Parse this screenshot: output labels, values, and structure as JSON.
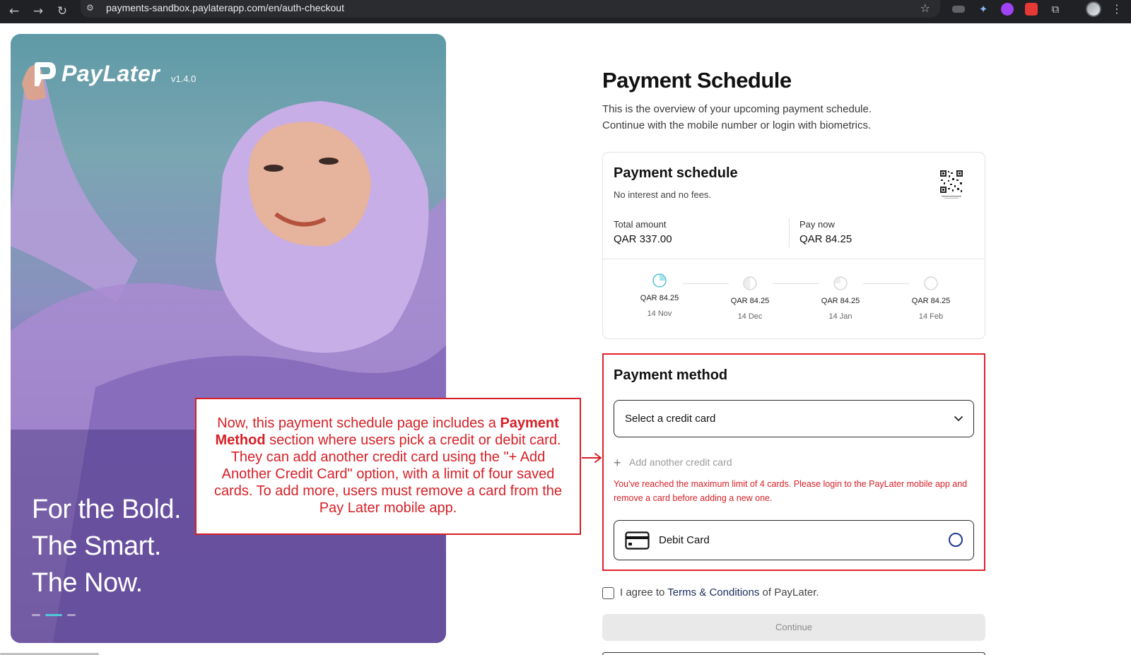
{
  "browser": {
    "url": "payments-sandbox.paylaterapp.com/en/auth-checkout",
    "icons": [
      "back-icon",
      "forward-icon",
      "reload-icon",
      "site-settings-icon",
      "bookmark-star-icon",
      "extensions-icon",
      "profile-avatar",
      "menu-icon"
    ]
  },
  "hero": {
    "brand_name": "PayLater",
    "version": "v1.4.0",
    "taglines": [
      "For the Bold.",
      "The Smart.",
      "The Now."
    ],
    "carousel_active_index": 1,
    "accent_color": "#52c6d8"
  },
  "header": {
    "title": "Payment Schedule",
    "subtitle_line1": "This is the overview of your upcoming payment schedule.",
    "subtitle_line2": "Continue with the mobile number or login with biometrics."
  },
  "schedule": {
    "title": "Payment schedule",
    "subtitle": "No interest and no fees.",
    "total_label": "Total amount",
    "total_value": "QAR 337.00",
    "paynow_label": "Pay now",
    "paynow_value": "QAR 84.25",
    "installments": [
      {
        "amount": "QAR 84.25",
        "date": "14 Nov",
        "progress": 0.25,
        "active": true
      },
      {
        "amount": "QAR 84.25",
        "date": "14 Dec",
        "progress": 0.5,
        "active": false
      },
      {
        "amount": "QAR 84.25",
        "date": "14 Jan",
        "progress": 0.75,
        "active": false
      },
      {
        "amount": "QAR 84.25",
        "date": "14 Feb",
        "progress": 1.0,
        "active": false
      }
    ]
  },
  "payment_method": {
    "title": "Payment method",
    "select_label": "Select a credit card",
    "add_card_label": "Add another credit card",
    "error": "You've reached the maximum limit of 4 cards. Please login to the PayLater mobile app and remove a card before adding a new one.",
    "option_label": "Debit Card",
    "highlight_color": "#e0212b"
  },
  "terms": {
    "prefix": "I agree to",
    "link": "Terms & Conditions",
    "suffix": "of PayLater."
  },
  "continue_label": "Continue",
  "callout": {
    "text_before": "Now, this payment schedule page includes a",
    "bold": "Payment Method",
    "text_after": "section where users pick a credit or debit card. They can add another credit card using the \"+ Add Another Credit Card\" option, with a limit of four saved cards. To add more, users must remove a card from the Pay Later mobile app.",
    "color": "#d61f26"
  }
}
